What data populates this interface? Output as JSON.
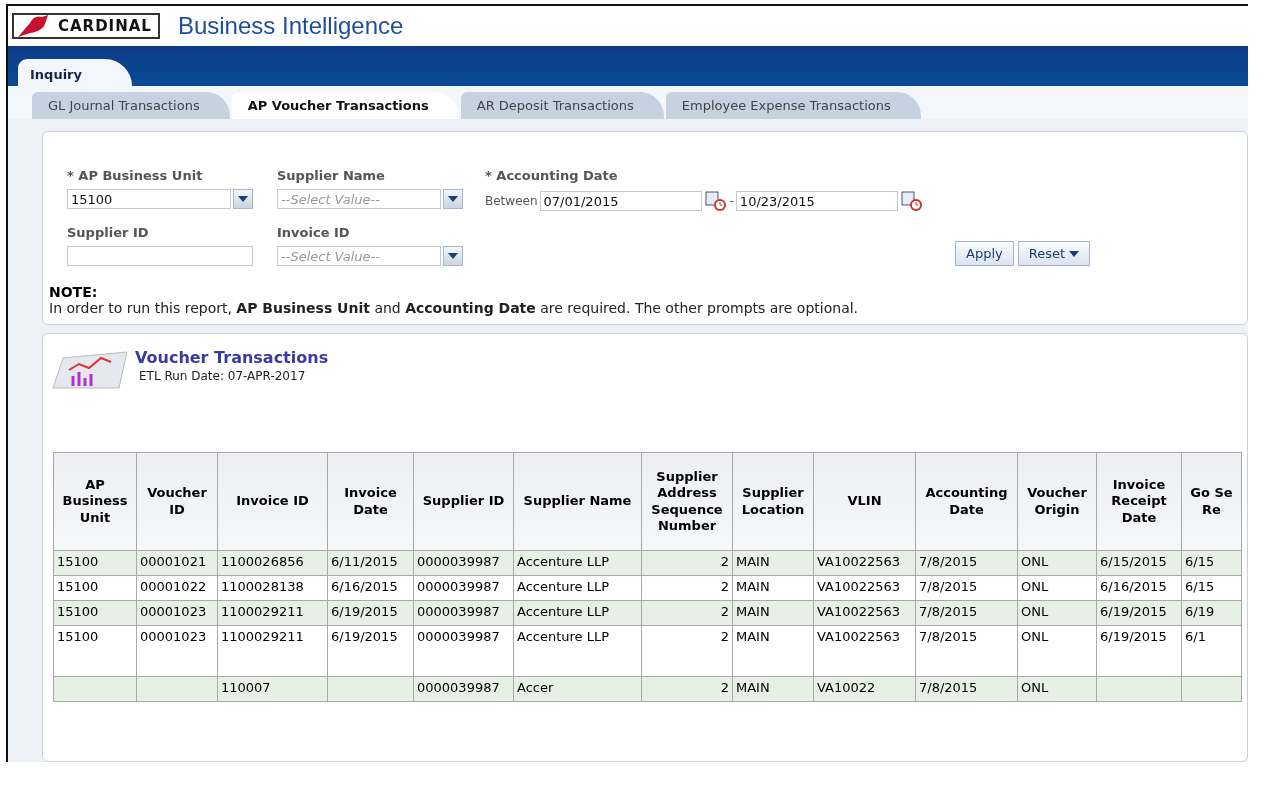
{
  "header": {
    "logo_text": "CARDINAL",
    "title": "Business Intelligence"
  },
  "main_tab": {
    "label": "Inquiry",
    "selected": true
  },
  "tabs": [
    {
      "label": "GL Journal Transactions",
      "selected": false
    },
    {
      "label": "AP Voucher Transactions",
      "selected": true
    },
    {
      "label": "AR Deposit Transactions",
      "selected": false
    },
    {
      "label": "Employee Expense Transactions",
      "selected": false
    }
  ],
  "prompts": {
    "ap_business_unit": {
      "label": "* AP Business Unit",
      "value": "15100"
    },
    "supplier_name": {
      "label": "Supplier Name",
      "placeholder": "--Select Value--"
    },
    "accounting_date": {
      "label": "* Accounting Date",
      "between": "Between",
      "from": "07/01/2015",
      "separator": "-",
      "to": "10/23/2015"
    },
    "supplier_id": {
      "label": "Supplier ID"
    },
    "invoice_id": {
      "label": "Invoice ID",
      "placeholder": "--Select Value--"
    },
    "buttons": [
      {
        "label": "Apply",
        "kind": "plain"
      },
      {
        "label": "Reset",
        "kind": "menu"
      }
    ]
  },
  "note": {
    "title": "NOTE:",
    "text": "In order to run this report, **AP Business Unit** and **Accounting Date** are required. The other prompts are optional."
  },
  "report": {
    "title": "Voucher Transactions",
    "subtitle": "ETL Run Date: 07-APR-2017"
  },
  "table": {
    "columns": [
      "AP Business Unit",
      "Voucher ID",
      "Invoice ID",
      "Invoice Date",
      "Supplier ID",
      "Supplier Name",
      "Supplier Address Sequence Number",
      "Supplier Location",
      "VLIN",
      "Accounting Date",
      "Voucher Origin",
      "Invoice Receipt Date",
      "Go Se Re"
    ],
    "rows": [
      {
        "cells": [
          "15100",
          "00001021",
          "1100026856",
          "6/11/2015",
          "0000039987",
          "Accenture LLP",
          "2",
          "MAIN",
          "VA10022563",
          "7/8/2015",
          "ONL",
          "6/15/2015",
          "6/15"
        ]
      },
      {
        "cells": [
          "15100",
          "00001022",
          "1100028138",
          "6/16/2015",
          "0000039987",
          "Accenture LLP",
          "2",
          "MAIN",
          "VA10022563",
          "7/8/2015",
          "ONL",
          "6/16/2015",
          "6/15"
        ]
      },
      {
        "cells": [
          "15100",
          "00001023",
          "1100029211",
          "6/19/2015",
          "0000039987",
          "Accenture LLP",
          "2",
          "MAIN",
          "VA10022563",
          "7/8/2015",
          "ONL",
          "6/19/2015",
          "6/19"
        ]
      },
      {
        "cells": [
          "15100",
          "00001023",
          "1100029211",
          "6/19/2015",
          "0000039987",
          "Accenture LLP",
          "2",
          "MAIN",
          "VA10022563",
          "7/8/2015",
          "ONL",
          "6/19/2015",
          "6/1"
        ]
      },
      {
        "cells": [
          null,
          null,
          "110007",
          null,
          "0000039987",
          "Accer",
          "2",
          "MAIN",
          "VA10022",
          "7/8/2015",
          "ONL",
          null,
          null
        ]
      }
    ]
  }
}
